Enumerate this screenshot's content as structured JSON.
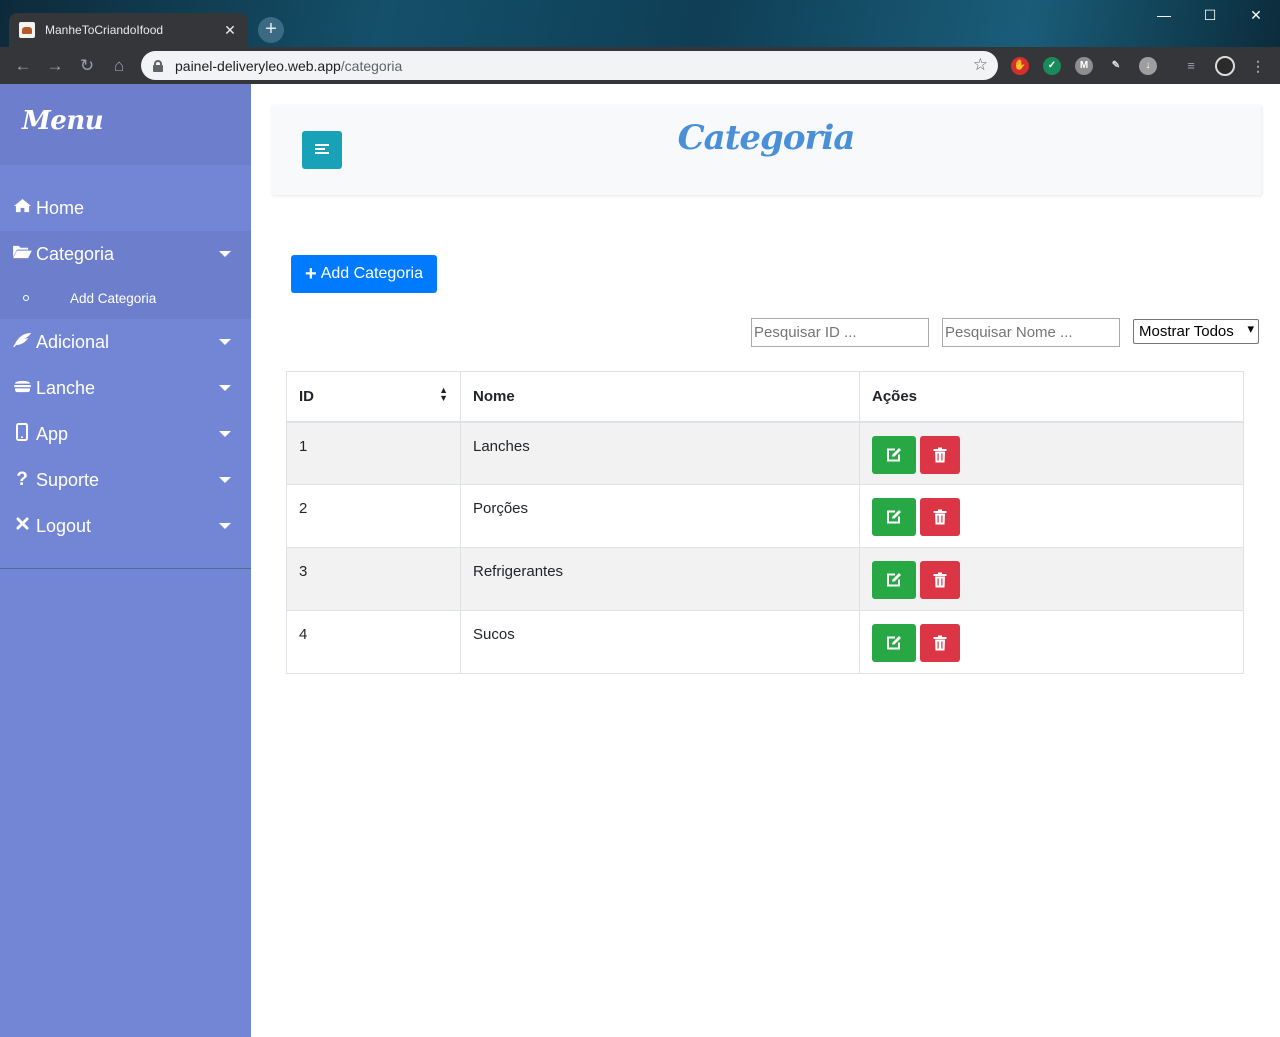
{
  "browser": {
    "tab_title": "ManheToCriandoIfood",
    "url_host": "painel-deliveryleo.web.app",
    "url_path": "/categoria"
  },
  "sidebar": {
    "brand": "Menu",
    "items": [
      {
        "label": "Home",
        "icon": "home-icon"
      },
      {
        "label": "Categoria",
        "icon": "folder-open-icon"
      },
      {
        "label": "Adicional",
        "icon": "feather-icon"
      },
      {
        "label": "Lanche",
        "icon": "burger-icon"
      },
      {
        "label": "App",
        "icon": "mobile-icon"
      },
      {
        "label": "Suporte",
        "icon": "question-icon"
      },
      {
        "label": "Logout",
        "icon": "close-icon"
      }
    ],
    "subitem": "Add Categoria"
  },
  "header": {
    "title": "Categoria"
  },
  "main": {
    "add_button": "Add Categoria",
    "search_id_placeholder": "Pesquisar ID ...",
    "search_name_placeholder": "Pesquisar Nome ...",
    "filter_select": "Mostrar Todos",
    "table": {
      "headers": [
        "ID",
        "Nome",
        "Ações"
      ],
      "rows": [
        {
          "id": "1",
          "nome": "Lanches"
        },
        {
          "id": "2",
          "nome": "Porções"
        },
        {
          "id": "3",
          "nome": "Refrigerantes"
        },
        {
          "id": "4",
          "nome": "Sucos"
        }
      ]
    }
  },
  "colors": {
    "sidebar": "#7386d5",
    "sidebar_active": "#6d7fcc",
    "primary": "#007bff",
    "info": "#17a2b8",
    "success": "#28a745",
    "danger": "#dc3545",
    "title": "#4a90d9"
  }
}
